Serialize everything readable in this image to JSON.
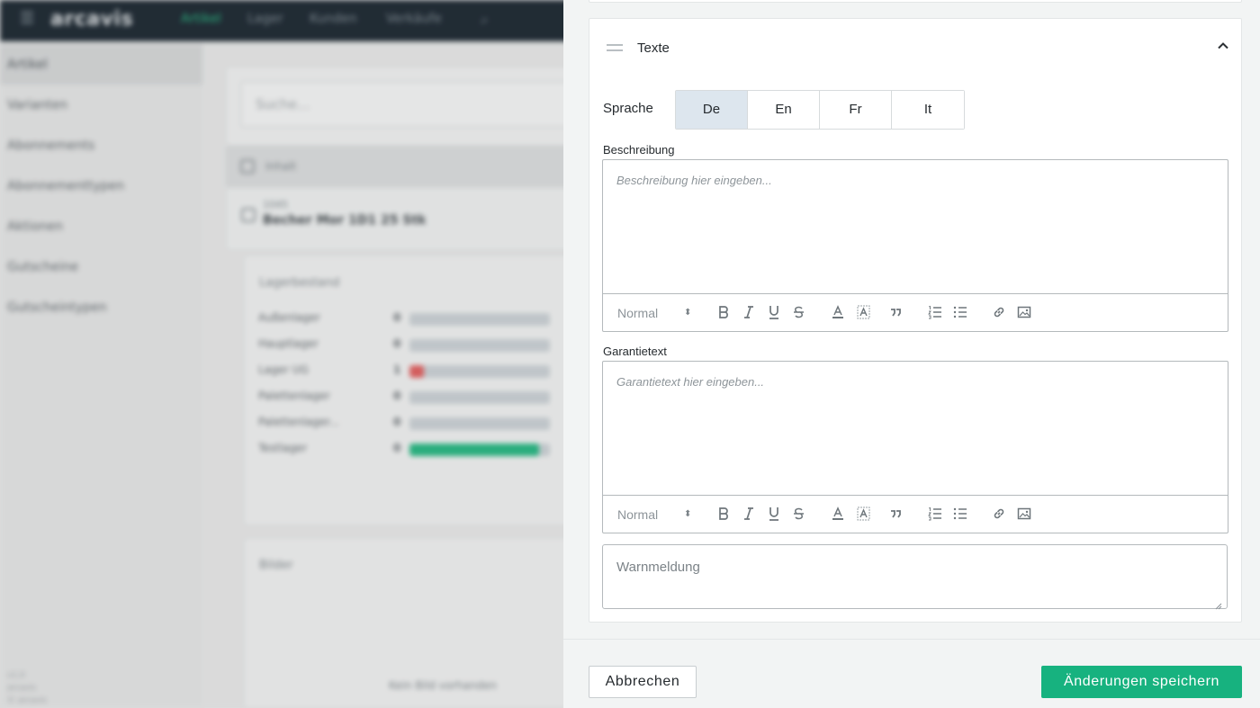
{
  "background": {
    "app_name": "arcavis",
    "nav": [
      "Artikel",
      "Lager",
      "Kunden",
      "Verkäufe"
    ],
    "sidebar_items": [
      "Artikel",
      "Varianten",
      "Abonnements",
      "Abonnementtypen",
      "Aktionen",
      "Gutscheine",
      "Gutscheintypen"
    ],
    "search_placeholder": "Suche...",
    "list_header": "Inhalt",
    "product_code": "1045",
    "product_name": "Becher Mor 1D1 25 Stk",
    "stock_title": "Lagerbestand",
    "stock_rows": [
      {
        "label": "Außenlager",
        "qty": "0",
        "fill": 0
      },
      {
        "label": "Hauptlager",
        "qty": "0",
        "fill": 0
      },
      {
        "label": "Lager UG",
        "qty": "1",
        "fill": 0.1
      },
      {
        "label": "Palettenlager",
        "qty": "0",
        "fill": 0
      },
      {
        "label": "Palettenlager...",
        "qty": "0",
        "fill": 0
      },
      {
        "label": "Testlager",
        "qty": "0",
        "fill": 0.92
      }
    ],
    "images_title": "Bilder",
    "no_images": "Kein Bild vorhanden",
    "footer_lines": [
      "v1.0",
      "arcavis",
      "© arcavis"
    ],
    "colors": {
      "topbar": "#15212b",
      "accent": "#1fb57e",
      "danger": "#e05a5a"
    }
  },
  "panel": {
    "title": "Texte",
    "language_label": "Sprache",
    "languages": [
      "De",
      "En",
      "Fr",
      "It"
    ],
    "active_language": "De",
    "description_label": "Beschreibung",
    "description_placeholder": "Beschreibung hier eingeben...",
    "warranty_label": "Garantietext",
    "warranty_placeholder": "Garantietext hier eingeben...",
    "format_select": "Normal",
    "toolbar_icons": [
      "bold-icon",
      "italic-icon",
      "underline-icon",
      "strike-icon",
      "text-color-icon",
      "highlight-icon",
      "blockquote-icon",
      "ordered-list-icon",
      "bullet-list-icon",
      "link-icon",
      "image-icon"
    ],
    "warning_placeholder": "Warnmeldung"
  },
  "footer": {
    "cancel_label": "Abbrechen",
    "save_label": "Änderungen speichern",
    "save_color": "#17b27f"
  }
}
